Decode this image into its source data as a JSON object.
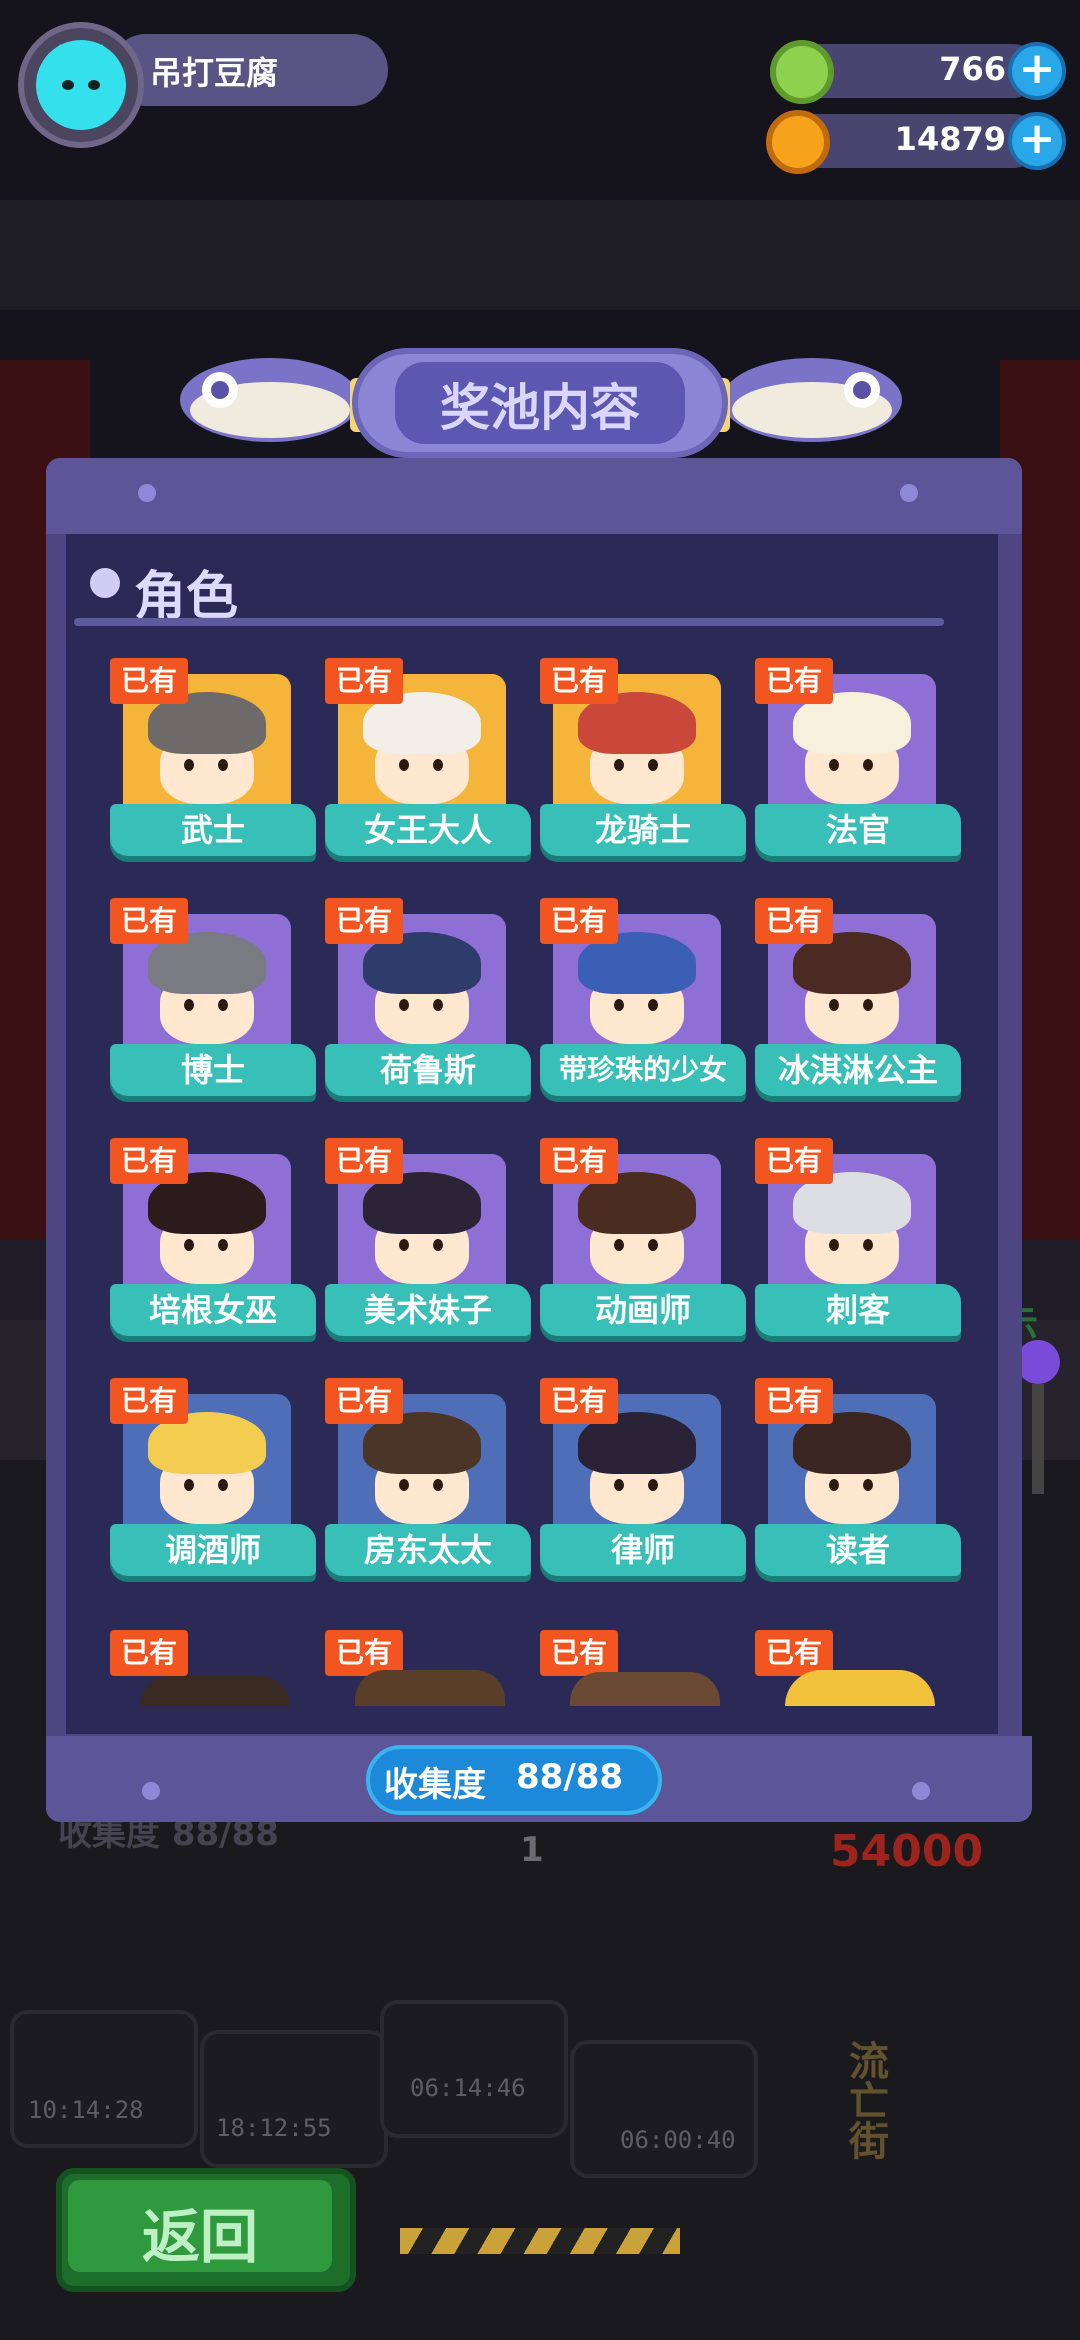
{
  "player": {
    "name": "吊打豆腐"
  },
  "currencies": [
    {
      "name": "gem",
      "value": "766",
      "color": "#8fd14f"
    },
    {
      "name": "coin",
      "value": "14879",
      "color": "#f7a21b"
    }
  ],
  "modal": {
    "title": "奖池内容",
    "section_title": "角色",
    "owned_label": "已有",
    "collection_label": "收集度",
    "collection_value": "88/88"
  },
  "characters": [
    {
      "name": "武士",
      "bg": "#f5b53a",
      "hair": "#6f6a6a"
    },
    {
      "name": "女王大人",
      "bg": "#f5b53a",
      "hair": "#f1efe8"
    },
    {
      "name": "龙骑士",
      "bg": "#f5b53a",
      "hair": "#c9483a"
    },
    {
      "name": "法官",
      "bg": "#8d6fd6",
      "hair": "#f7f0dc"
    },
    {
      "name": "博士",
      "bg": "#8d6fd6",
      "hair": "#7a7a82"
    },
    {
      "name": "荷鲁斯",
      "bg": "#8d6fd6",
      "hair": "#2e3c6b"
    },
    {
      "name": "带珍珠的少女",
      "bg": "#8d6fd6",
      "hair": "#3b5fb5"
    },
    {
      "name": "冰淇淋公主",
      "bg": "#8d6fd6",
      "hair": "#4a2a22"
    },
    {
      "name": "培根女巫",
      "bg": "#8d6fd6",
      "hair": "#2a1c1a"
    },
    {
      "name": "美术妹子",
      "bg": "#8d6fd6",
      "hair": "#2b2436"
    },
    {
      "name": "动画师",
      "bg": "#8d6fd6",
      "hair": "#4a2c20"
    },
    {
      "name": "刺客",
      "bg": "#8d6fd6",
      "hair": "#dddde4"
    },
    {
      "name": "调酒师",
      "bg": "#4e6fb7",
      "hair": "#f2cd4f"
    },
    {
      "name": "房东太太",
      "bg": "#4e6fb7",
      "hair": "#4b3527"
    },
    {
      "name": "律师",
      "bg": "#4e6fb7",
      "hair": "#2a2338"
    },
    {
      "name": "读者",
      "bg": "#4e6fb7",
      "hair": "#3a2520"
    }
  ],
  "background": {
    "ghost_collection": "收集度 88/88",
    "price": "54000",
    "count": "1",
    "timers": [
      "10:14:28",
      "18:12:55",
      "06:14:46",
      "06:00:40"
    ],
    "side_text": "示",
    "sign_text": "流亡街"
  },
  "buttons": {
    "back": "返回"
  }
}
